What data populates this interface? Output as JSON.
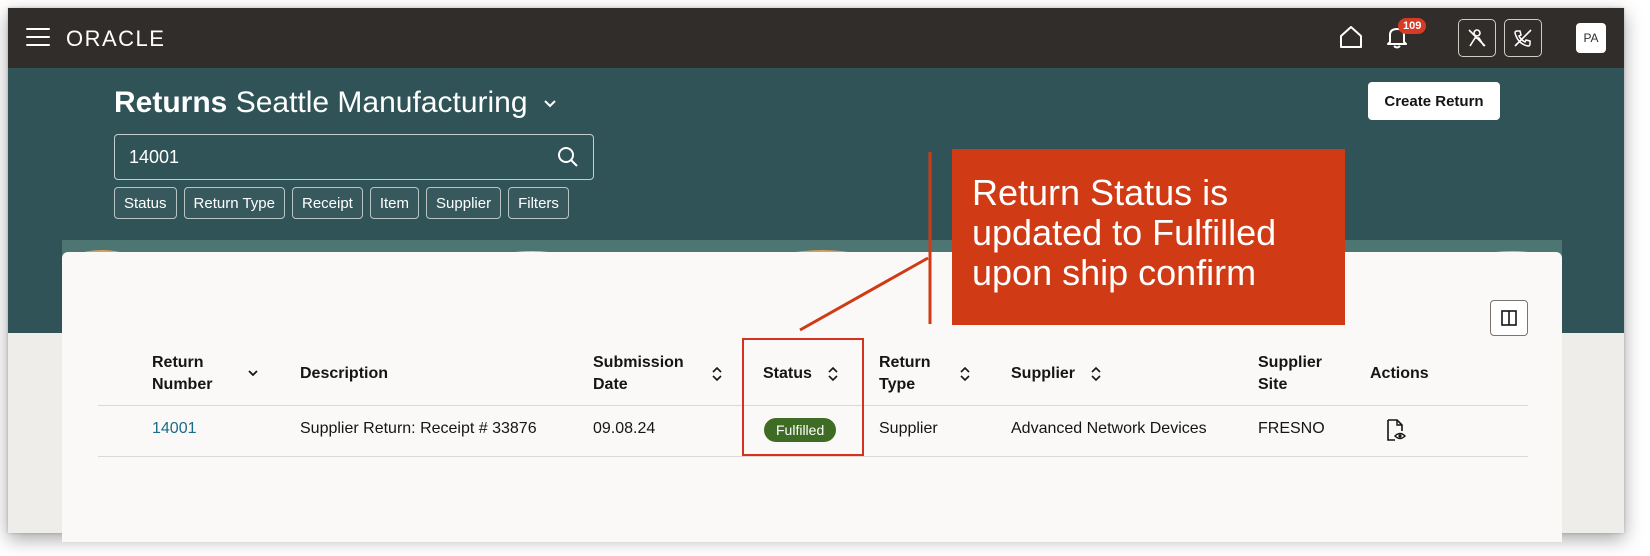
{
  "topbar": {
    "logo": "ORACLE",
    "notification_count": "109",
    "avatar_initials": "PA"
  },
  "header": {
    "title_bold": "Returns",
    "title_rest": "Seattle Manufacturing",
    "create_button": "Create Return"
  },
  "search": {
    "value": "14001"
  },
  "filter_chips": [
    "Status",
    "Return Type",
    "Receipt",
    "Item",
    "Supplier",
    "Filters"
  ],
  "table": {
    "columns": {
      "return_number": [
        "Return",
        "Number"
      ],
      "description": "Description",
      "submission_date": [
        "Submission",
        "Date"
      ],
      "status": "Status",
      "return_type": [
        "Return",
        "Type"
      ],
      "supplier": "Supplier",
      "supplier_site": [
        "Supplier",
        "Site"
      ],
      "actions": "Actions"
    },
    "rows": [
      {
        "return_number": "14001",
        "description": "Supplier Return: Receipt # 33876",
        "submission_date": "09.08.24",
        "status": "Fulfilled",
        "return_type": "Supplier",
        "supplier": "Advanced Network Devices",
        "supplier_site": "FRESNO"
      }
    ]
  },
  "callout": {
    "text": "Return Status is updated to Fulfilled upon ship confirm"
  },
  "colors": {
    "topbar": "#312d2a",
    "banner": "#2f5357",
    "callout": "#d03a14",
    "status_fulfilled": "#3f6c25",
    "highlight": "#d6301f"
  }
}
